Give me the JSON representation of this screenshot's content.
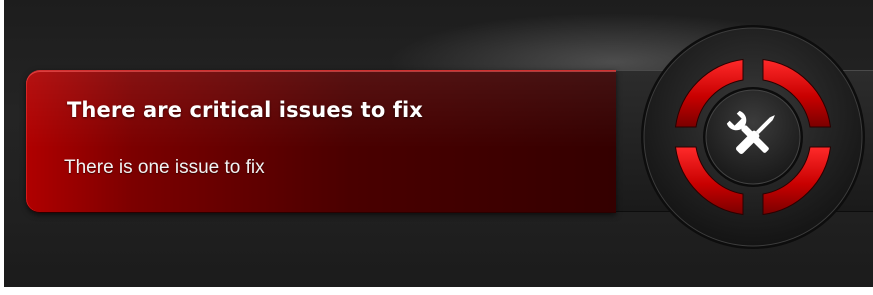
{
  "alert": {
    "title": "There are critical issues to fix",
    "subtitle": "There is one issue to fix"
  },
  "dial": {
    "icon": "tools-icon",
    "ring_color": "#e01010",
    "icon_color": "#ffffff"
  },
  "colors": {
    "background": "#222222",
    "banner": "#7c0000",
    "accent": "#e01010"
  }
}
